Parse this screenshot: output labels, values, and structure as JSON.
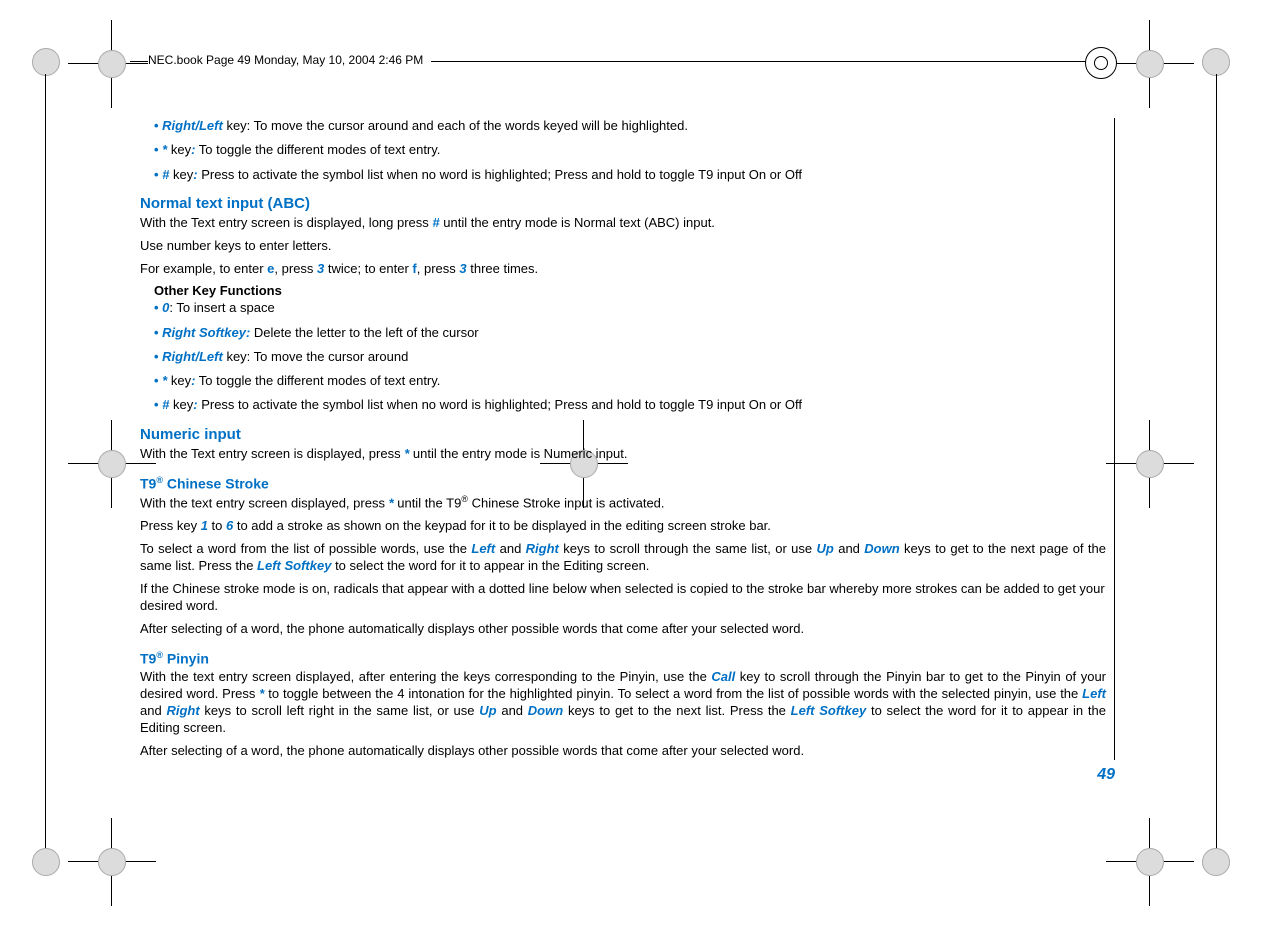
{
  "header": {
    "text": "NEC.book  Page 49  Monday, May 10, 2004  2:46 PM"
  },
  "top_bullets": {
    "b1_key": "Right/Left",
    "b1_text": " key: To move the cursor around and each of the words keyed will be highlighted.",
    "b2_key": "*",
    "b2_text": " key",
    "b2_colon": ":",
    "b2_rest": " To toggle the different modes of text entry.",
    "b3_key": "#",
    "b3_text": " key",
    "b3_colon": ":",
    "b3_rest": " Press to activate the symbol list when no word is highlighted; Press and hold to toggle T9 input On or Off"
  },
  "sec_normal": {
    "heading": "Normal text input (ABC)",
    "p1_a": "With the Text entry screen is displayed, long press ",
    "p1_key": "#",
    "p1_b": " until the entry mode is Normal text (ABC) input.",
    "p2": "Use number keys to enter letters.",
    "p3_a": "For example, to enter ",
    "p3_e": "e",
    "p3_b": ", press ",
    "p3_3a": "3",
    "p3_c": " twice; to enter ",
    "p3_f": "f",
    "p3_d": ", press ",
    "p3_3b": "3",
    "p3_e2": " three times.",
    "other_title": "Other Key Functions",
    "ob1_key": "0",
    "ob1_text": ": To insert a space",
    "ob2_key": "Right Softkey:",
    "ob2_text": " Delete the letter to the left of the cursor",
    "ob3_key": "Right/Left",
    "ob3_text": " key: To move the cursor around",
    "ob4_key": "*",
    "ob4_text": " key",
    "ob4_colon": ":",
    "ob4_rest": " To toggle the different modes of text entry.",
    "ob5_key": "#",
    "ob5_text": " key",
    "ob5_colon": ":",
    "ob5_rest": " Press to activate the symbol list when no word is highlighted; Press and hold to toggle T9 input On or Off"
  },
  "sec_numeric": {
    "heading": "Numeric input",
    "p1_a": "With the Text entry screen is displayed, press ",
    "p1_key": "*",
    "p1_b": " until the entry mode is Numeric input."
  },
  "sec_stroke": {
    "heading_a": "T9",
    "heading_sup": "®",
    "heading_b": " Chinese Stroke",
    "p1_a": "With the text entry screen displayed, press ",
    "p1_key": "*",
    "p1_b": " until the T9",
    "p1_sup": "®",
    "p1_c": " Chinese Stroke input is activated.",
    "p2_a": "Press key ",
    "p2_1": "1",
    "p2_b": " to ",
    "p2_6": "6",
    "p2_c": " to add a stroke as shown on the keypad for it to be displayed in the editing screen stroke bar.",
    "p3_a": "To select a word from the list of possible words, use the ",
    "p3_left": "Left",
    "p3_b": " and ",
    "p3_right": "Right",
    "p3_c": " keys to scroll through the same list, or use ",
    "p3_up": "Up",
    "p3_d": " and ",
    "p3_down": "Down",
    "p3_e": " keys to get to the next page of the same list. Press the ",
    "p3_lsk": "Left Softkey",
    "p3_f": " to select the word for it to appear in the Editing screen.",
    "p4": "If the Chinese stroke mode is on, radicals that appear with a dotted line below when selected is copied to the stroke bar whereby more strokes can be added to get your desired word.",
    "p5": "After selecting of a word, the phone automatically displays other possible words that come after your selected word."
  },
  "sec_pinyin": {
    "heading_a": "T9",
    "heading_sup": "®",
    "heading_b": " Pinyin",
    "p1_a": "With the text entry screen displayed, after entering  the keys corresponding to the Pinyin, use the ",
    "p1_call": "Call",
    "p1_b": " key to scroll through the Pinyin bar to get to the Pinyin of your desired word. Press ",
    "p1_star": "*",
    "p1_c": " to toggle between the 4 intonation for the highlighted pinyin. To select a word from the list of possible words with the selected pinyin, use the ",
    "p1_left": "Left",
    "p1_d": " and ",
    "p1_right": "Right",
    "p1_e": " keys to scroll left right in the same list, or use ",
    "p1_up": "Up",
    "p1_f": " and ",
    "p1_down": "Down",
    "p1_g": " keys to get to the next list. Press the ",
    "p1_lsk": "Left Softkey",
    "p1_h": " to select the word for it to appear in the Editing screen.",
    "p2": "After selecting of a word, the phone automatically displays other possible words that come after your selected word."
  },
  "page_number": "49"
}
